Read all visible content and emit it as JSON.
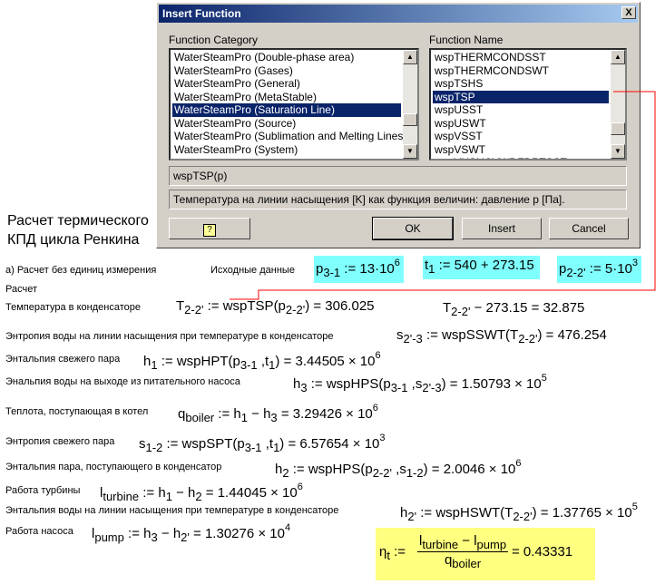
{
  "dialog": {
    "title": "Insert Function",
    "close_label": "X",
    "category_label": "Function Category",
    "name_label": "Function Name",
    "categories": [
      "WaterSteamPro (Double-phase area)",
      "WaterSteamPro (Gases)",
      "WaterSteamPro (General)",
      "WaterSteamPro (MetaStable)",
      "WaterSteamPro (Saturation Line)",
      "WaterSteamPro (Source)",
      "WaterSteamPro (Sublimation and Melting Lines)",
      "WaterSteamPro (System)"
    ],
    "selected_category": "WaterSteamPro (Saturation Line)",
    "functions": [
      "wspTHERMCONDSST",
      "wspTHERMCONDSWT",
      "wspTSHS",
      "wspTSP",
      "wspUSST",
      "wspUSWT",
      "wspVSST",
      "wspVSWT",
      "wspVUSHCVWDFDPTSST"
    ],
    "selected_function": "wspTSP",
    "signature": "wspTSP(p)",
    "description": "Температура на линии насыщения [K] как функция величин: давление p [Па].",
    "help_icon": "help-icon",
    "ok_label": "OK",
    "insert_label": "Insert",
    "cancel_label": "Cancel"
  },
  "worksheet": {
    "heading_line1": "Расчет термического",
    "heading_line2": "КПД цикла Ренкина",
    "section_a": "а) Расчет без единиц измерения",
    "section_calc": "Расчет",
    "initial_data_label": "Исходные данные",
    "inputs": {
      "p31": {
        "name": "p",
        "sub": "3-1",
        "rhs": " := 13·10",
        "exp": "6"
      },
      "t1": {
        "name": "t",
        "sub": "1",
        "rhs": " := 540 + 273.15"
      },
      "p22": {
        "name": "p",
        "sub": "2-2'",
        "rhs": " := 5·10",
        "exp": "3"
      }
    },
    "rows": [
      {
        "label": "Температура в конденсаторе",
        "lhs": "T",
        "lhs_sub": "2-2'",
        "mid": " := wspTSP(p",
        "arg_sub": "2-2'",
        "close": ") = 306.025"
      },
      {
        "label": "Энтропия воды на линии насыщения при температуре в конденсаторе",
        "lhs": "s",
        "lhs_sub": "2'-3",
        "mid": " := wspSSWT(T",
        "arg_sub": "2-2'",
        "close": ") = 476.254"
      },
      {
        "label": "Энтальпия свежего пара",
        "lhs": "h",
        "lhs_sub": "1",
        "mid": " := wspHPT(p",
        "arg_sub": "3-1",
        "mid2": " ,t",
        "arg2_sub": "1",
        "close": ") = 3.44505 × 10",
        "exp": "6"
      },
      {
        "label": "Энальпия воды на выходе из питательного насоса",
        "lhs": "h",
        "lhs_sub": "3",
        "mid": " := wspHPS(p",
        "arg_sub": "3-1",
        "mid2": " ,s",
        "arg2_sub": "2'-3",
        "close": ") = 1.50793 × 10",
        "exp": "5"
      },
      {
        "label": "Теплота, поступающая в котел",
        "lhs": "q",
        "lhs_sub": "boiler",
        "mid": " := h",
        "arg_sub": "1",
        "mid2": " − h",
        "arg2_sub": "3",
        "close": " = 3.29426 × 10",
        "exp": "6"
      },
      {
        "label": "Энтропия свежего пара",
        "lhs": "s",
        "lhs_sub": "1-2",
        "mid": " := wspSPT(p",
        "arg_sub": "3-1",
        "mid2": " ,t",
        "arg2_sub": "1",
        "close": ") = 6.57654 × 10",
        "exp": "3"
      },
      {
        "label": "Энтальпия пара, поступающего в конденсатор",
        "lhs": "h",
        "lhs_sub": "2",
        "mid": " := wspHPS(p",
        "arg_sub": "2-2'",
        "mid2": " ,s",
        "arg2_sub": "1-2",
        "close": ") = 2.0046 × 10",
        "exp": "6"
      },
      {
        "label": "Работа турбины",
        "lhs": "l",
        "lhs_sub": "turbine",
        "mid": " := h",
        "arg_sub": "1",
        "mid2": " − h",
        "arg2_sub": "2",
        "close": " = 1.44045 × 10",
        "exp": "6"
      },
      {
        "label": "Энтальпия воды на линии насыщения при температуре в конденсаторе",
        "lhs": "h",
        "lhs_sub": "2'",
        "mid": " := wspHSWT(T",
        "arg_sub": "2-2'",
        "close": ") = 1.37765 × 10",
        "exp": "5"
      },
      {
        "label": "Работа насоса",
        "lhs": "l",
        "lhs_sub": "pump",
        "mid": " := h",
        "arg_sub": "3",
        "mid2": " − h",
        "arg2_sub": "2'",
        "close": " = 1.30276 × 10",
        "exp": "4"
      }
    ],
    "t22_celsius": {
      "lhs": "T",
      "lhs_sub": "2-2'",
      "rhs": " − 273.15 = 32.875"
    },
    "efficiency": {
      "lhs": "η",
      "lhs_sub": "t",
      "num_l1": "l",
      "num_l1_sub": "turbine",
      "num_minus": " − l",
      "num_l2_sub": "pump",
      "den": "q",
      "den_sub": "boiler",
      "result": " = 0.43331"
    }
  },
  "colors": {
    "highlight_cyan": "#80ffff",
    "highlight_yellow": "#ffff80",
    "connector_red": "#ff0000",
    "selection_blue": "#0a246a"
  }
}
